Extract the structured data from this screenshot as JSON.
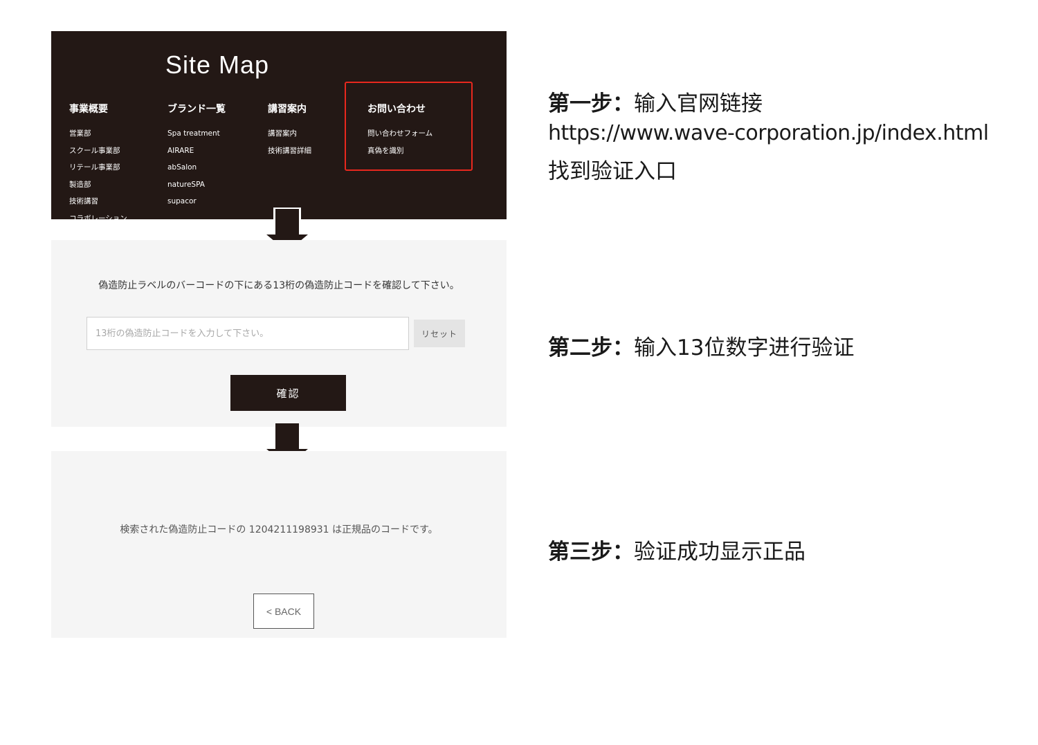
{
  "sitemap": {
    "title": "Site Map",
    "columns": [
      {
        "heading": "事業概要",
        "links": [
          "営業部",
          "スクール事業部",
          "リテール事業部",
          "製造部",
          "技術講習",
          "コラボレーション"
        ]
      },
      {
        "heading": "ブランド一覧",
        "links": [
          "Spa treatment",
          "AIRARE",
          "abSalon",
          "natureSPA",
          "supacor"
        ]
      },
      {
        "heading": "講習案内",
        "links": [
          "講習案内",
          "技術講習詳細"
        ]
      },
      {
        "heading": "お問い合わせ",
        "links": [
          "問い合わせフォーム",
          "真偽を識別"
        ]
      }
    ],
    "highlight_color": "#e8281e"
  },
  "verify": {
    "instruction": "偽造防止ラベルのバーコードの下にある13桁の偽造防止コードを確認して下さい。",
    "input_placeholder": "13桁の偽造防止コードを入力して下さい。",
    "input_value": "",
    "reset_label": "リセット",
    "confirm_label": "確認"
  },
  "result": {
    "message": "検索された偽造防止コードの 1204211198931 は正規品のコードです。",
    "back_label": "< BACK"
  },
  "steps": {
    "step1_label": "第一步：",
    "step1_text": "输入官网链接",
    "step1_url": "https://www.wave-corporation.jp/index.html",
    "step1_note": "找到验证入口",
    "step2_label": "第二步：",
    "step2_text": "输入13位数字进行验证",
    "step3_label": "第三步：",
    "step3_text": "验证成功显示正品"
  },
  "colors": {
    "dark_panel": "#231815",
    "light_panel": "#f5f5f5",
    "highlight": "#e8281e"
  },
  "icons": {
    "arrow": "arrow-down-icon"
  }
}
